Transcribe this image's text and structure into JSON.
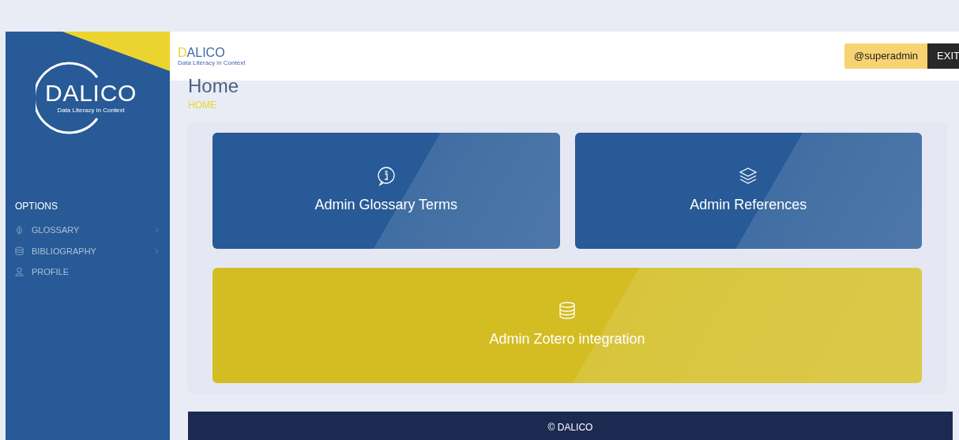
{
  "sidebar": {
    "logo": {
      "title": "DALICO",
      "subtitle": "Data Literacy in Context"
    },
    "section": "OPTIONS",
    "items": [
      {
        "label": "GLOSSARY",
        "kind": "leaf",
        "submenu": true
      },
      {
        "label": "BIBLIOGRAPHY",
        "kind": "database",
        "submenu": true
      },
      {
        "label": "PROFILE",
        "kind": "person",
        "submenu": false
      }
    ]
  },
  "header": {
    "logo": {
      "initial": "D",
      "rest": "ALICO",
      "subtitle": "Data Literacy in Context"
    },
    "user": "@superadmin",
    "exit": "EXIT"
  },
  "page": {
    "title": "Home",
    "breadcrumb": "HOME"
  },
  "cards": [
    {
      "label": "Admin Glossary Terms",
      "kind": "info",
      "color": "#275a96"
    },
    {
      "label": "Admin References",
      "kind": "layers",
      "color": "#275a96"
    },
    {
      "label": "Admin Zotero integration",
      "kind": "database",
      "color": "#d3bd22"
    }
  ],
  "footer": "© DALICO"
}
